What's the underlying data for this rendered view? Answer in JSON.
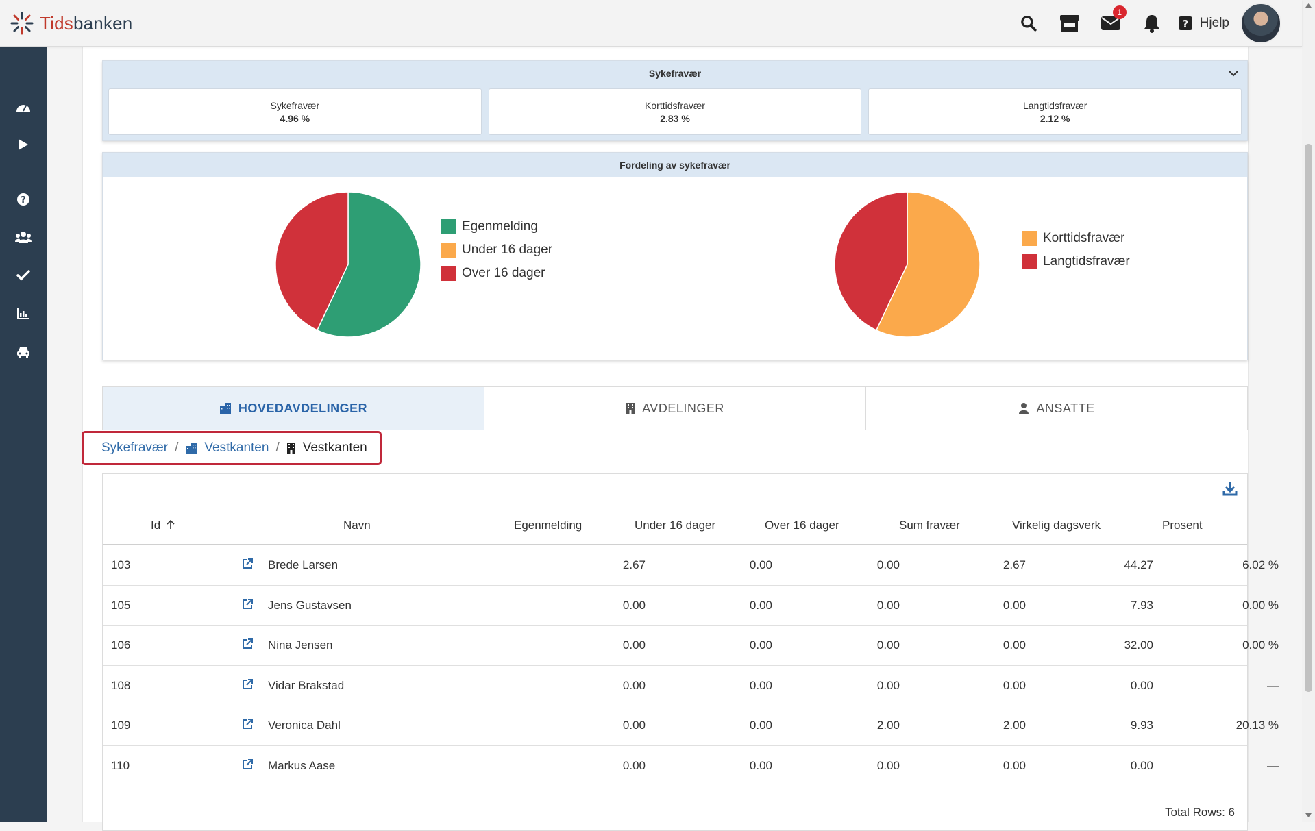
{
  "header": {
    "logo_prefix": "Tids",
    "logo_suffix": "banken",
    "mail_badge": "1",
    "help_label": "Hjelp"
  },
  "sidebar": {
    "items": [
      "dashboard-icon",
      "play-icon",
      "question-icon",
      "users-icon",
      "check-icon",
      "chart-icon",
      "car-icon"
    ]
  },
  "summary": {
    "title": "Sykefravær",
    "stats": [
      {
        "label": "Sykefravær",
        "value": "4.96 %"
      },
      {
        "label": "Korttidsfravær",
        "value": "2.83 %"
      },
      {
        "label": "Langtidsfravær",
        "value": "2.12 %"
      }
    ]
  },
  "distribution": {
    "title": "Fordeling av sykefravær"
  },
  "chart_data": [
    {
      "type": "pie",
      "categories": [
        "Egenmelding",
        "Under 16 dager",
        "Over 16 dager"
      ],
      "values": [
        57.0,
        0.0,
        43.0
      ],
      "colors": [
        "#2e9e74",
        "#fba94b",
        "#d0313a"
      ]
    },
    {
      "type": "pie",
      "categories": [
        "Korttidsfravær",
        "Langtidsfravær"
      ],
      "values": [
        57.0,
        43.0
      ],
      "colors": [
        "#fba94b",
        "#d0313a"
      ]
    }
  ],
  "tabs": [
    {
      "label": "HOVEDAVDELINGER",
      "icon": "building-group-icon"
    },
    {
      "label": "AVDELINGER",
      "icon": "building-icon"
    },
    {
      "label": "ANSATTE",
      "icon": "user-icon"
    }
  ],
  "breadcrumb": {
    "root": "Sykefravær",
    "sep": "/",
    "level1": "Vestkanten",
    "current": "Vestkanten"
  },
  "table": {
    "columns": [
      "Id",
      "Navn",
      "Egenmelding",
      "Under 16 dager",
      "Over 16 dager",
      "Sum fravær",
      "Virkelig dagsverk",
      "Prosent"
    ],
    "rows": [
      [
        "103",
        "Brede Larsen",
        "2.67",
        "0.00",
        "0.00",
        "2.67",
        "44.27",
        "6.02 %"
      ],
      [
        "105",
        "Jens Gustavsen",
        "0.00",
        "0.00",
        "0.00",
        "0.00",
        "7.93",
        "0.00 %"
      ],
      [
        "106",
        "Nina Jensen",
        "0.00",
        "0.00",
        "0.00",
        "0.00",
        "32.00",
        "0.00 %"
      ],
      [
        "108",
        "Vidar Brakstad",
        "0.00",
        "0.00",
        "0.00",
        "0.00",
        "0.00",
        "—"
      ],
      [
        "109",
        "Veronica Dahl",
        "0.00",
        "0.00",
        "2.00",
        "2.00",
        "9.93",
        "20.13 %"
      ],
      [
        "110",
        "Markus Aase",
        "0.00",
        "0.00",
        "0.00",
        "0.00",
        "0.00",
        "—"
      ]
    ],
    "total": "Total Rows: 6"
  }
}
